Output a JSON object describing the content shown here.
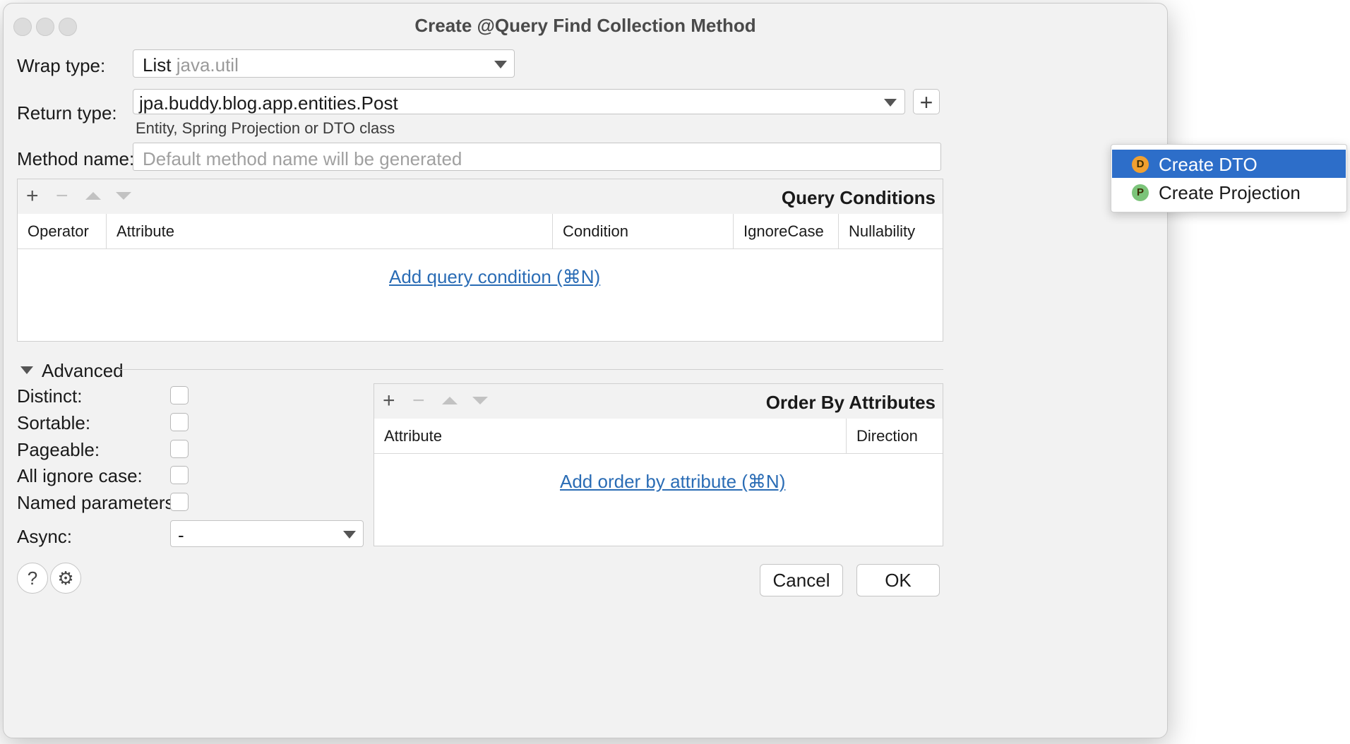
{
  "dialog": {
    "title": "Create @Query Find Collection Method"
  },
  "fields": {
    "wrap_type_label": "Wrap type:",
    "wrap_type_value": "List",
    "wrap_type_package": "java.util",
    "return_type_label": "Return type:",
    "return_type_value": "jpa.buddy.blog.app.entities.Post",
    "return_type_hint": "Entity, Spring Projection or DTO class",
    "method_name_label": "Method name:",
    "method_name_placeholder": "Default method name will be generated"
  },
  "query_conditions": {
    "title": "Query Conditions",
    "columns": [
      "Operator",
      "Attribute",
      "Condition",
      "IgnoreCase",
      "Nullability"
    ],
    "empty_link": "Add query condition (⌘N)"
  },
  "advanced": {
    "label": "Advanced",
    "options": [
      {
        "label": "Distinct:",
        "checked": false
      },
      {
        "label": "Sortable:",
        "checked": false
      },
      {
        "label": "Pageable:",
        "checked": false
      },
      {
        "label": "All ignore case:",
        "checked": false
      },
      {
        "label": "Named parameters:",
        "checked": false
      }
    ],
    "async_label": "Async:",
    "async_value": "-"
  },
  "order_by": {
    "title": "Order By Attributes",
    "columns": [
      "Attribute",
      "Direction"
    ],
    "empty_link": "Add order by attribute (⌘N)"
  },
  "buttons": {
    "cancel": "Cancel",
    "ok": "OK",
    "help_glyph": "?",
    "settings_glyph": "⚙"
  },
  "popup_menu": {
    "items": [
      {
        "label": "Create DTO",
        "badge": "D",
        "badge_color": "#f0a030",
        "selected": true
      },
      {
        "label": "Create Projection",
        "badge": "P",
        "badge_color": "#7cc47a",
        "selected": false
      }
    ],
    "selection_color": "#2d6ec9"
  },
  "colors": {
    "link": "#2a6cb5",
    "dialog_bg": "#f2f2f2"
  }
}
